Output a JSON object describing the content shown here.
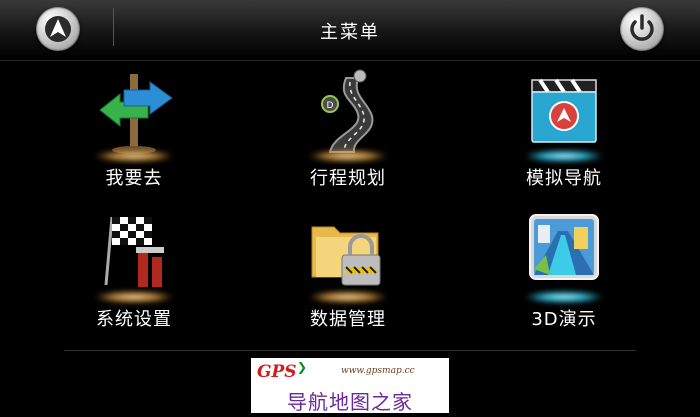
{
  "header": {
    "title": "主菜单"
  },
  "menu": [
    {
      "label": "我要去",
      "icon": "signpost-icon"
    },
    {
      "label": "行程规划",
      "icon": "route-icon"
    },
    {
      "label": "模拟导航",
      "icon": "clapperboard-icon"
    },
    {
      "label": "系统设置",
      "icon": "flags-settings-icon"
    },
    {
      "label": "数据管理",
      "icon": "folder-lock-icon"
    },
    {
      "label": "3D演示",
      "icon": "3d-road-icon"
    }
  ],
  "banner": {
    "logo": "GPS",
    "url": "www.gpsmap.cc",
    "slogan": "导航地图之家"
  },
  "colors": {
    "background": "#000000",
    "label": "#ffffff",
    "banner_text": "#6a2a9a",
    "banner_logo": "#d31b1b"
  }
}
